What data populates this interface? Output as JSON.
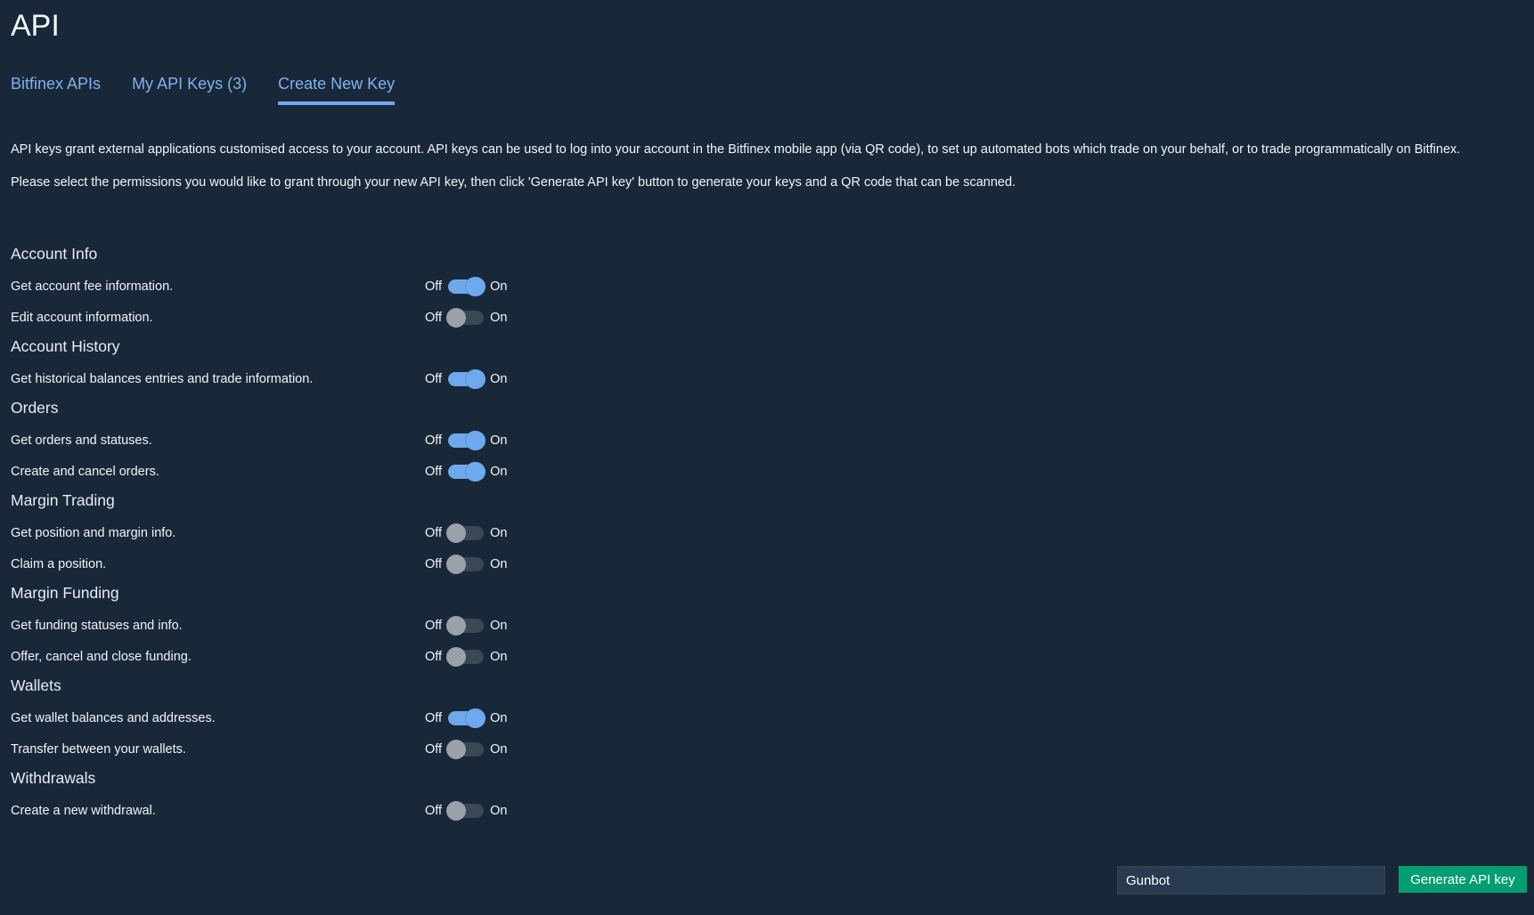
{
  "page": {
    "title": "API"
  },
  "tabs": [
    {
      "label": "Bitfinex APIs",
      "active": false
    },
    {
      "label": "My API Keys (3)",
      "active": false
    },
    {
      "label": "Create New Key",
      "active": true
    }
  ],
  "description": [
    "API keys grant external applications customised access to your account. API keys can be used to log into your account in the Bitfinex mobile app (via QR code), to set up automated bots which trade on your behalf, or to trade programmatically on Bitfinex.",
    "Please select the permissions you would like to grant through your new API key, then click 'Generate API key' button to generate your keys and a QR code that can be scanned."
  ],
  "toggle_labels": {
    "off": "Off",
    "on": "On"
  },
  "sections": [
    {
      "title": "Account Info",
      "items": [
        {
          "label": "Get account fee information.",
          "enabled": true
        },
        {
          "label": "Edit account information.",
          "enabled": false
        }
      ]
    },
    {
      "title": "Account History",
      "items": [
        {
          "label": "Get historical balances entries and trade information.",
          "enabled": true
        }
      ]
    },
    {
      "title": "Orders",
      "items": [
        {
          "label": "Get orders and statuses.",
          "enabled": true
        },
        {
          "label": "Create and cancel orders.",
          "enabled": true
        }
      ]
    },
    {
      "title": "Margin Trading",
      "items": [
        {
          "label": "Get position and margin info.",
          "enabled": false
        },
        {
          "label": "Claim a position.",
          "enabled": false
        }
      ]
    },
    {
      "title": "Margin Funding",
      "items": [
        {
          "label": "Get funding statuses and info.",
          "enabled": false
        },
        {
          "label": "Offer, cancel and close funding.",
          "enabled": false
        }
      ]
    },
    {
      "title": "Wallets",
      "items": [
        {
          "label": "Get wallet balances and addresses.",
          "enabled": true
        },
        {
          "label": "Transfer between your wallets.",
          "enabled": false
        }
      ]
    },
    {
      "title": "Withdrawals",
      "items": [
        {
          "label": "Create a new withdrawal.",
          "enabled": false
        }
      ]
    }
  ],
  "footer": {
    "key_name_value": "Gunbot",
    "generate_label": "Generate API key"
  },
  "colors": {
    "background": "#182838",
    "accent": "#6ea9ee",
    "button": "#039d73"
  }
}
